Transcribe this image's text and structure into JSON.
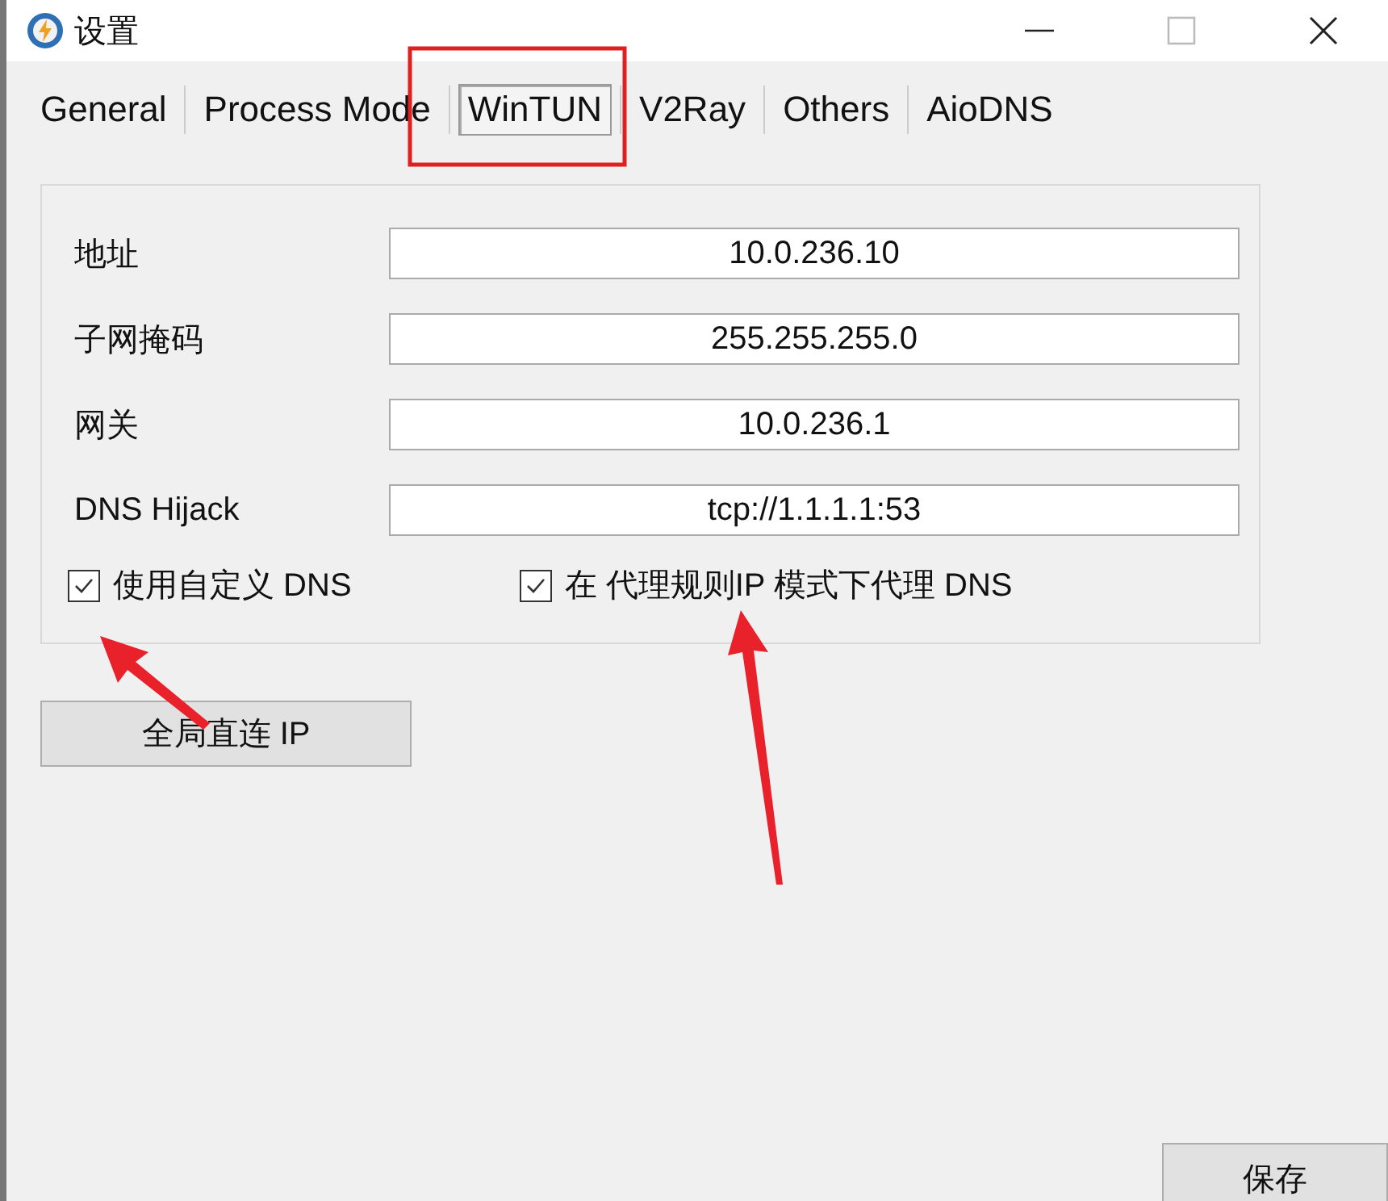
{
  "window": {
    "title": "设置"
  },
  "tabs": [
    {
      "label": "General",
      "selected": false
    },
    {
      "label": "Process Mode",
      "selected": false
    },
    {
      "label": "WinTUN",
      "selected": true
    },
    {
      "label": "V2Ray",
      "selected": false
    },
    {
      "label": "Others",
      "selected": false
    },
    {
      "label": "AioDNS",
      "selected": false
    }
  ],
  "fields": [
    {
      "label": "地址",
      "value": "10.0.236.10"
    },
    {
      "label": "子网掩码",
      "value": "255.255.255.0"
    },
    {
      "label": "网关",
      "value": "10.0.236.1"
    },
    {
      "label": "DNS Hijack",
      "value": "tcp://1.1.1.1:53"
    }
  ],
  "checkboxes": [
    {
      "label": "使用自定义 DNS",
      "checked": true
    },
    {
      "label": "在 代理规则IP 模式下代理 DNS",
      "checked": true
    }
  ],
  "direct_ip_button": "全局直连 IP",
  "save_button": "保存"
}
